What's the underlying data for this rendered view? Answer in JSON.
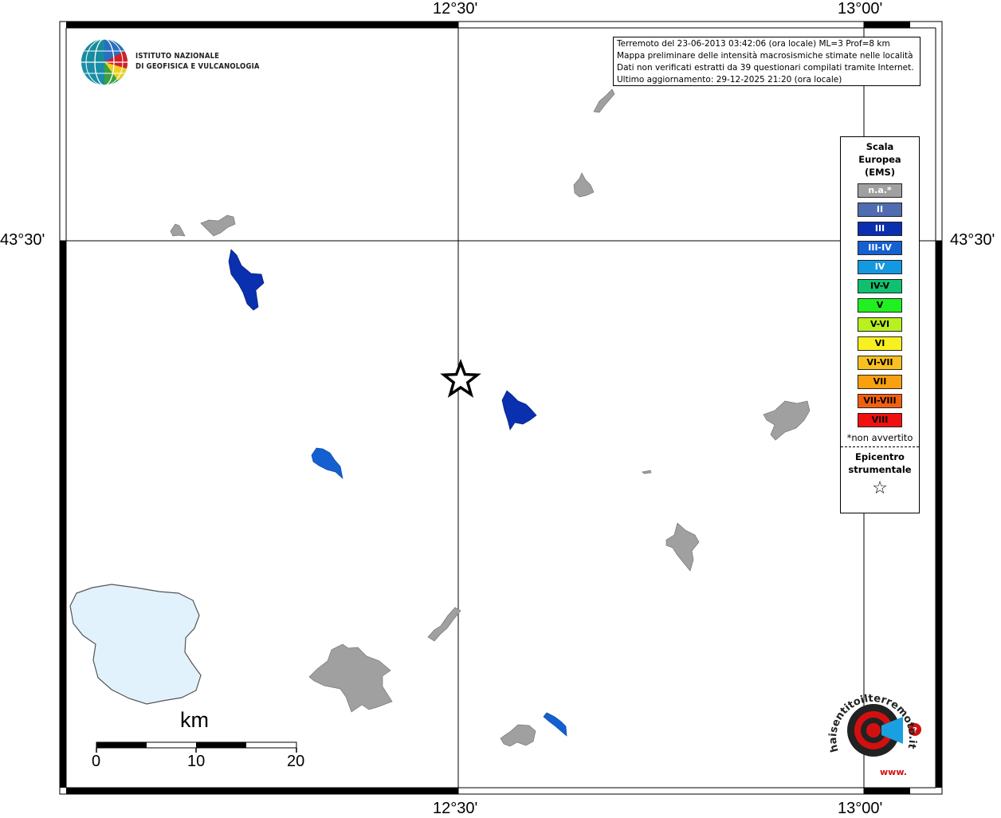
{
  "coord_labels": {
    "top_lon_1": "12°30'",
    "top_lon_2": "13°00'",
    "bottom_lon_1": "12°30'",
    "bottom_lon_2": "13°00'",
    "left_lat": "43°30'",
    "right_lat": "43°30'"
  },
  "institute": {
    "line1": "ISTITUTO NAZIONALE",
    "line2": "DI GEOFISICA E VULCANOLOGIA"
  },
  "info_box": {
    "line1": "Terremoto del 23-06-2013 03:42:06 (ora locale) ML=3 Prof=8 km",
    "line2": "Mappa preliminare delle intensità macrosismiche stimate nelle località",
    "line3": "Dati non verificati estratti da 39 questionari compilati tramite Internet.",
    "line4": "Ultimo aggiornamento: 29-12-2025 21:20 (ora locale)"
  },
  "legend": {
    "title_1": "Scala",
    "title_2": "Europea",
    "title_3": "(EMS)",
    "items": [
      {
        "label": "n.a.*",
        "color": "#a0a0a0",
        "text_color": "#ffffff"
      },
      {
        "label": "II",
        "color": "#4f6db0",
        "text_color": "#ffffff"
      },
      {
        "label": "III",
        "color": "#0a30b0",
        "text_color": "#ffffff"
      },
      {
        "label": "III-IV",
        "color": "#1560d0",
        "text_color": "#ffffff"
      },
      {
        "label": "IV",
        "color": "#1498e0",
        "text_color": "#ffffff"
      },
      {
        "label": "IV-V",
        "color": "#10c070",
        "text_color": "#000000"
      },
      {
        "label": "V",
        "color": "#20f020",
        "text_color": "#000000"
      },
      {
        "label": "V-VI",
        "color": "#b8f020",
        "text_color": "#000000"
      },
      {
        "label": "VI",
        "color": "#f8f020",
        "text_color": "#000000"
      },
      {
        "label": "VI-VII",
        "color": "#f8c020",
        "text_color": "#000000"
      },
      {
        "label": "VII",
        "color": "#f8a010",
        "text_color": "#000000"
      },
      {
        "label": "VII-VIII",
        "color": "#f06010",
        "text_color": "#000000"
      },
      {
        "label": "VIII",
        "color": "#f01010",
        "text_color": "#000000"
      }
    ],
    "note": "*non avvertito",
    "epicenter_1": "Epicentro",
    "epicenter_2": "strumentale"
  },
  "scale_bar": {
    "unit": "km",
    "ticks": [
      "0",
      "10",
      "20"
    ]
  },
  "haisentito": {
    "text": "haisentitoilterremoto.it",
    "prefix": "www."
  },
  "colors": {
    "na_gray": "#a0a0a0",
    "ems_III": "#0a30b0",
    "ems_III_IV": "#1560d0",
    "lake_fill": "#e2f2fc"
  }
}
